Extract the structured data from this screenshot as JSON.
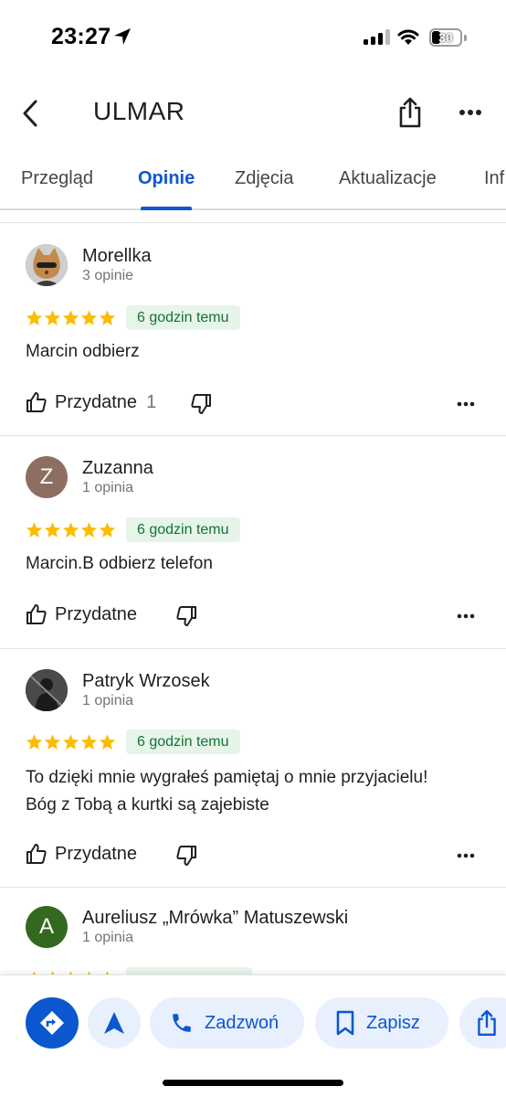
{
  "status_bar": {
    "time": "23:27",
    "battery": "30"
  },
  "header": {
    "title": "ULMAR"
  },
  "tabs": [
    {
      "label": "Przegląd"
    },
    {
      "label": "Opinie"
    },
    {
      "label": "Zdjęcia"
    },
    {
      "label": "Aktualizacje"
    },
    {
      "label": "Inf"
    }
  ],
  "reviews": [
    {
      "name": "Morellka",
      "count": "3 opinie",
      "rating": 5,
      "time": "6 godzin temu",
      "text": "Marcin odbierz",
      "helpful_label": "Przydatne",
      "helpful_count": "1"
    },
    {
      "name": "Zuzanna",
      "count": "1 opinia",
      "avatar_letter": "Z",
      "rating": 5,
      "time": "6 godzin temu",
      "text": "Marcin.B odbierz telefon",
      "helpful_label": "Przydatne"
    },
    {
      "name": "Patryk Wrzosek",
      "count": "1 opinia",
      "rating": 5,
      "time": "6 godzin temu",
      "text_line1": "To dzięki mnie wygrałeś pamiętaj o mnie przyjacielu!",
      "text_line2": "Bóg z Tobą a kurtki są zajebiste",
      "helpful_label": "Przydatne"
    },
    {
      "name": "Aureliusz „Mrówka” Matuszewski",
      "count": "1 opinia",
      "avatar_letter": "A"
    }
  ],
  "actions": {
    "call_label": "Zadzwoń",
    "save_label": "Zapisz"
  },
  "colors": {
    "accent": "#0b57d0",
    "star": "#fbbc04",
    "badge_bg": "#e6f4ea",
    "badge_text": "#137333",
    "avatar_z": "#8d6e63",
    "avatar_a": "#33691e"
  }
}
